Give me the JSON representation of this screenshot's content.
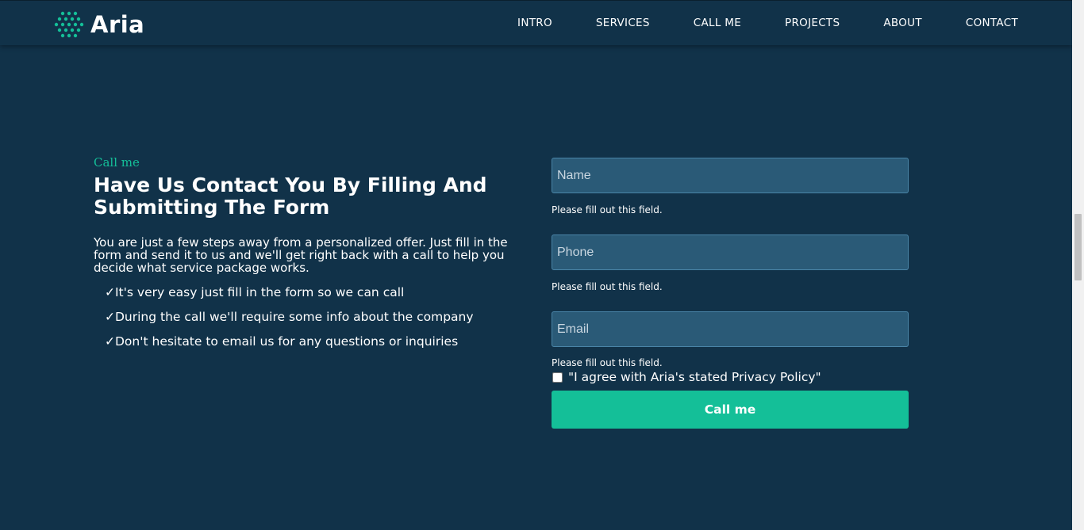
{
  "brand": {
    "name": "Aria",
    "accent_color": "#14bf98",
    "background_color": "#113249",
    "logo_icon": "dot-grid-logo-icon"
  },
  "nav": {
    "items": [
      {
        "label": "INTRO"
      },
      {
        "label": "SERVICES"
      },
      {
        "label": "CALL ME"
      },
      {
        "label": "PROJECTS"
      },
      {
        "label": "ABOUT"
      },
      {
        "label": "CONTACT"
      }
    ]
  },
  "section": {
    "eyebrow": "Call me",
    "headline": "Have Us Contact You By Filling And Submitting The Form",
    "lead": "You are just a few steps away from a personalized offer. Just fill in the form and send it to us and we'll get right back with a call to help you decide what service package works.",
    "bullets": [
      "✓It's very easy just fill in the form so we can call",
      "✓During the call we'll require some info about the company",
      "✓Don't hesitate to email us for any questions or inquiries"
    ]
  },
  "form": {
    "name": {
      "value": "",
      "placeholder": "Name",
      "error": "Please fill out this field."
    },
    "phone": {
      "value": "",
      "placeholder": "Phone",
      "error": "Please fill out this field."
    },
    "email": {
      "value": "",
      "placeholder": "Email",
      "error": "Please fill out this field."
    },
    "agree_label": "\"I agree with Aria's stated Privacy Policy\"",
    "agree_checked": false,
    "submit_label": "Call me"
  }
}
